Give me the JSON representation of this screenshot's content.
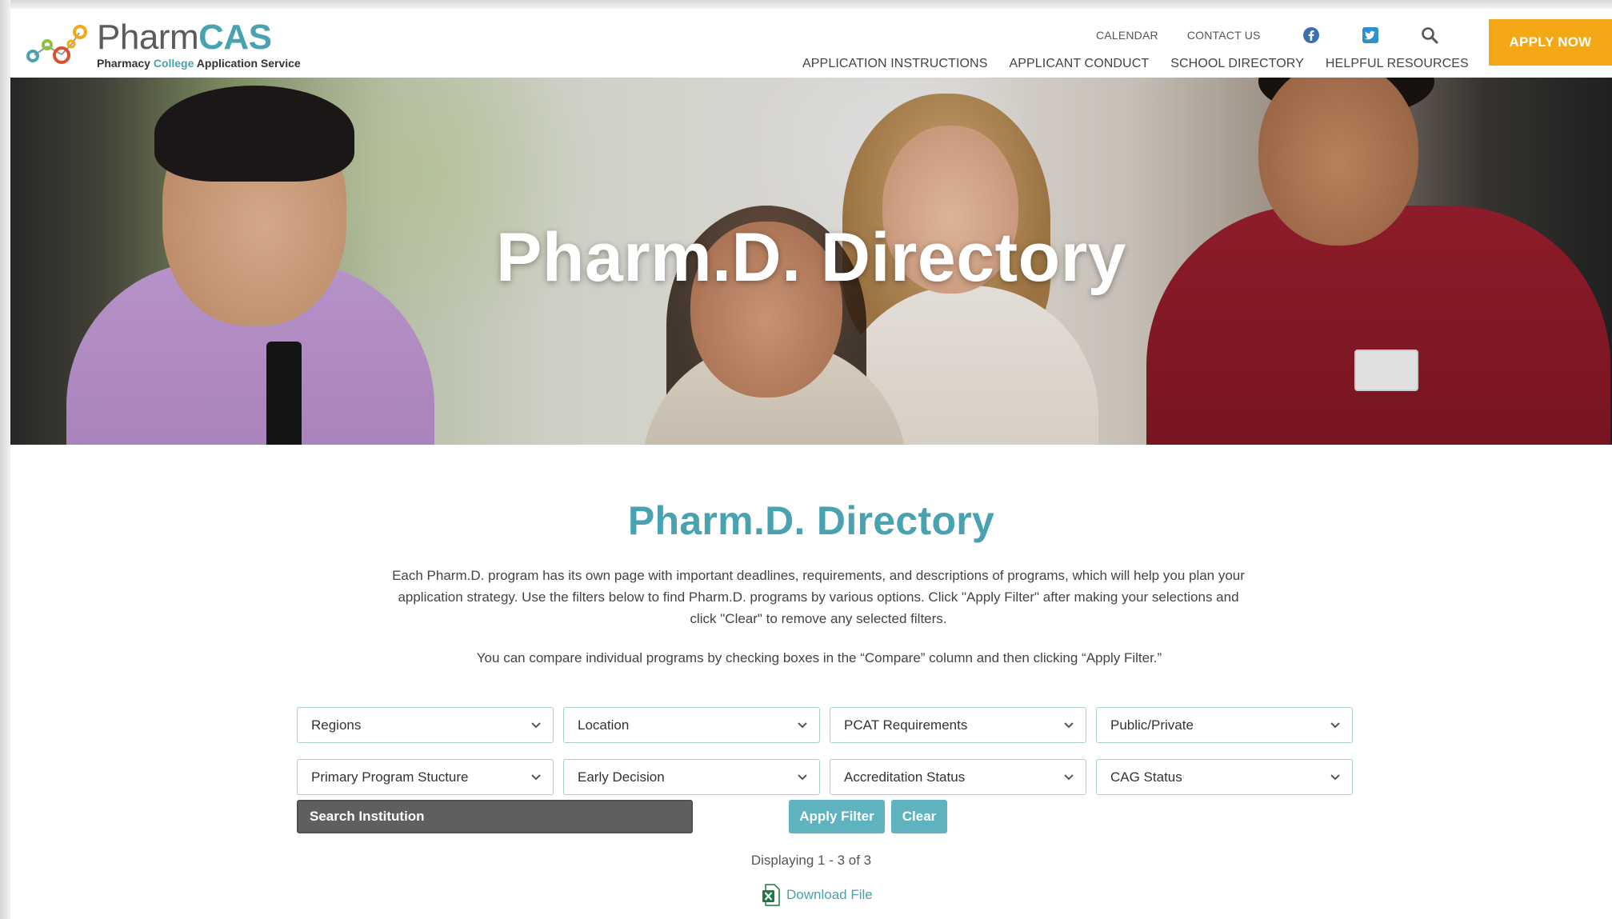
{
  "logo": {
    "title_a": "Pharm",
    "title_b": "CAS",
    "subtitle_a": "Pharmacy",
    "subtitle_b": "College",
    "subtitle_c": "Application Service"
  },
  "utility_nav": {
    "calendar": "CALENDAR",
    "contact": "CONTACT US",
    "icons": [
      "facebook-icon",
      "twitter-icon",
      "search-icon"
    ]
  },
  "main_nav": [
    {
      "label": "APPLICATION INSTRUCTIONS"
    },
    {
      "label": "APPLICANT CONDUCT"
    },
    {
      "label": "SCHOOL DIRECTORY"
    },
    {
      "label": "HELPFUL RESOURCES"
    }
  ],
  "apply_now": "APPLY NOW",
  "hero": {
    "title": "Pharm.D. Directory"
  },
  "main": {
    "title": "Pharm.D. Directory",
    "intro": "Each Pharm.D. program has its own page with important deadlines, requirements, and descriptions of programs, which will help you plan your application strategy. Use the filters below to find Pharm.D. programs by various options. Click \"Apply Filter\" after making your selections and click \"Clear\" to remove any selected filters.",
    "compare_note": "You can compare individual programs by checking boxes in the “Compare” column and then clicking “Apply Filter.”"
  },
  "filters": {
    "row1": [
      "Regions",
      "Location",
      "PCAT Requirements",
      "Public/Private"
    ],
    "row2": [
      "Primary Program Stucture",
      "Early Decision",
      "Accreditation Status",
      "CAG Status"
    ]
  },
  "search": {
    "placeholder": "Search Institution"
  },
  "buttons": {
    "apply": "Apply Filter",
    "clear": "Clear"
  },
  "results": {
    "displaying": "Displaying 1 - 3 of 3",
    "download": "Download File"
  },
  "colors": {
    "brand_teal": "#48a2b0",
    "apply_now": "#f5a816",
    "button_teal": "#5fb3bf",
    "filter_border": "#a7d0c8"
  }
}
